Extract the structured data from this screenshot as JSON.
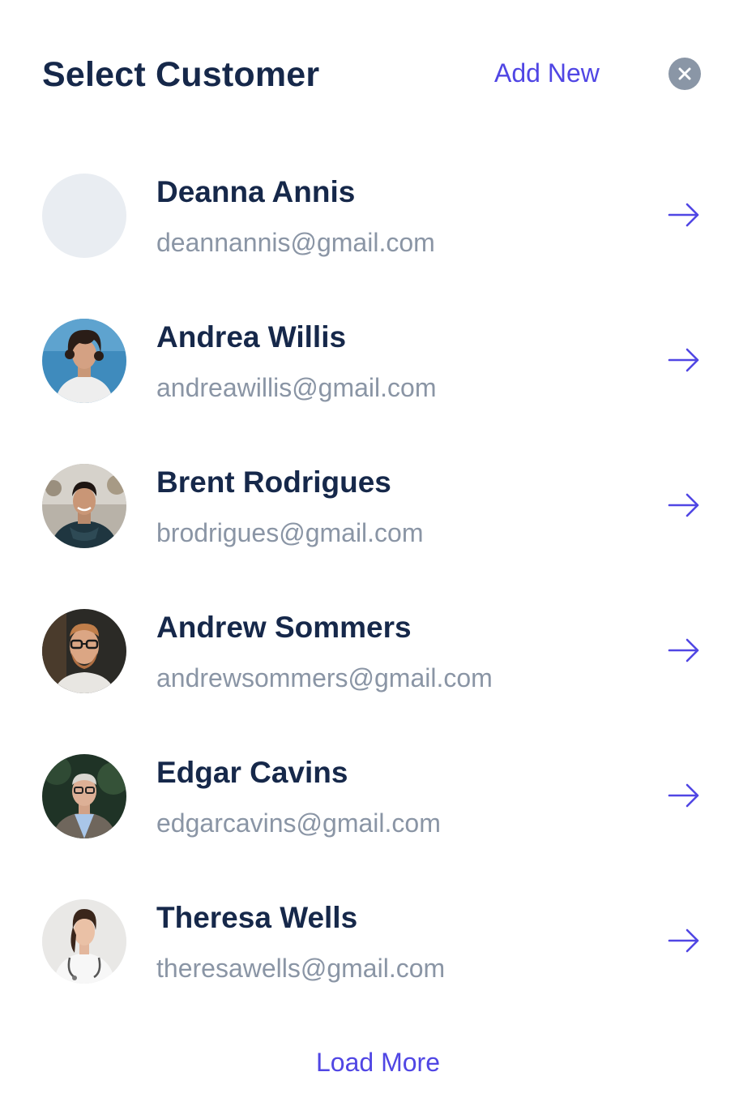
{
  "header": {
    "title": "Select Customer",
    "add_new_label": "Add New",
    "close_icon": "close-icon"
  },
  "customers": [
    {
      "name": "Deanna Annis",
      "email": "deannannis@gmail.com",
      "avatar": "placeholder"
    },
    {
      "name": "Andrea Willis",
      "email": "andreawillis@gmail.com",
      "avatar": "photo"
    },
    {
      "name": "Brent Rodrigues",
      "email": "brodrigues@gmail.com",
      "avatar": "photo"
    },
    {
      "name": "Andrew Sommers",
      "email": "andrewsommers@gmail.com",
      "avatar": "photo"
    },
    {
      "name": "Edgar Cavins",
      "email": "edgarcavins@gmail.com",
      "avatar": "photo"
    },
    {
      "name": "Theresa Wells",
      "email": "theresawells@gmail.com",
      "avatar": "photo"
    }
  ],
  "row_action_icon": "arrow-right-icon",
  "footer": {
    "load_more_label": "Load More"
  },
  "colors": {
    "accent": "#5046e4",
    "title": "#16284a",
    "muted": "#8a95a5",
    "placeholder_avatar": "#e9edf2"
  }
}
